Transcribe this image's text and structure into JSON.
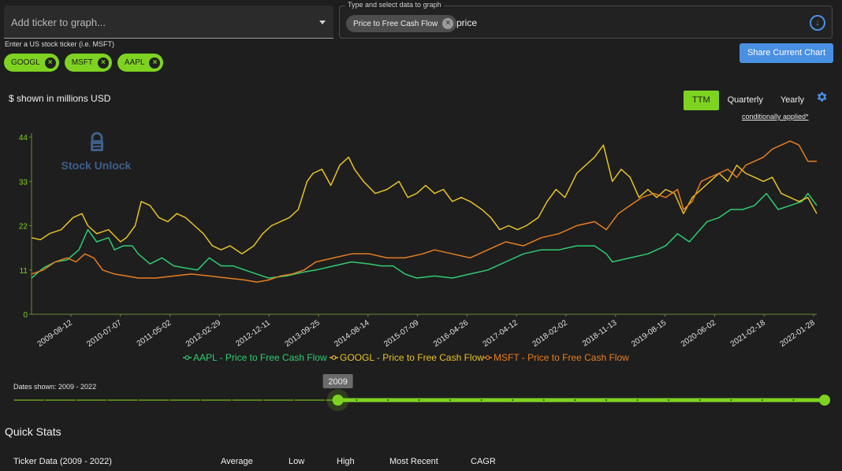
{
  "ticker_input": {
    "placeholder": "Add ticker to graph...",
    "helper": "Enter a US stock ticker (i.e. MSFT)"
  },
  "tickers": [
    {
      "label": "GOOGL",
      "remove_icon": "close-circle-icon"
    },
    {
      "label": "MSFT",
      "remove_icon": "close-circle-icon"
    },
    {
      "label": "AAPL",
      "remove_icon": "close-circle-icon"
    }
  ],
  "data_select": {
    "label": "Type and select data to graph",
    "selected_metric": "Price to Free Cash Flow",
    "typed_text": "price",
    "dropdown_icon": "arrow-down-circle-icon"
  },
  "share_button": "Share Current Chart",
  "units_note": "$ shown in millions USD",
  "period_tabs": {
    "ttm": "TTM",
    "quarterly": "Quarterly",
    "yearly": "Yearly",
    "active": "TTM"
  },
  "settings_icon": "gear-icon",
  "conditional_note": "conditionally applied*",
  "watermark": "Stock Unlock",
  "accent_color": "#7ed321",
  "button_color": "#4a90e2",
  "chart_data": {
    "type": "line",
    "title": "",
    "xlabel": "",
    "ylabel": "",
    "ylim": [
      0,
      44
    ],
    "yticks": [
      0,
      11,
      22,
      33,
      44
    ],
    "x_ticks": [
      "2009-08-12",
      "2010-07-07",
      "2011-05-02",
      "2012-02-29",
      "2012-12-11",
      "2013-09-25",
      "2014-08-14",
      "2015-07-09",
      "2016-04-26",
      "2017-04-12",
      "2018-02-02",
      "2018-11-13",
      "2019-08-15",
      "2020-06-02",
      "2021-02-18",
      "2022-01-28"
    ],
    "x_range": [
      2009.2,
      2022.45
    ],
    "grid": false,
    "legend_position": "bottom",
    "series": [
      {
        "name": "AAPL - Price to Free Cash Flow",
        "color": "#2ecc71",
        "points": [
          [
            2009.2,
            9
          ],
          [
            2009.4,
            11.5
          ],
          [
            2009.6,
            13
          ],
          [
            2009.8,
            13.5
          ],
          [
            2010.0,
            16
          ],
          [
            2010.15,
            21
          ],
          [
            2010.3,
            18
          ],
          [
            2010.5,
            19
          ],
          [
            2010.6,
            16
          ],
          [
            2010.75,
            17
          ],
          [
            2010.9,
            17
          ],
          [
            2011.0,
            15
          ],
          [
            2011.2,
            12.5
          ],
          [
            2011.4,
            14
          ],
          [
            2011.6,
            12
          ],
          [
            2011.8,
            11.5
          ],
          [
            2012.0,
            11
          ],
          [
            2012.2,
            14
          ],
          [
            2012.4,
            12
          ],
          [
            2012.6,
            12
          ],
          [
            2012.8,
            11
          ],
          [
            2013.0,
            10
          ],
          [
            2013.2,
            9
          ],
          [
            2013.5,
            9.5
          ],
          [
            2013.8,
            10.5
          ],
          [
            2014.0,
            11
          ],
          [
            2014.3,
            12
          ],
          [
            2014.6,
            13
          ],
          [
            2014.9,
            12.5
          ],
          [
            2015.1,
            12
          ],
          [
            2015.3,
            12
          ],
          [
            2015.5,
            10
          ],
          [
            2015.7,
            9
          ],
          [
            2016.0,
            9.5
          ],
          [
            2016.3,
            9
          ],
          [
            2016.6,
            10
          ],
          [
            2016.9,
            11
          ],
          [
            2017.2,
            13
          ],
          [
            2017.5,
            15
          ],
          [
            2017.8,
            16
          ],
          [
            2018.1,
            16
          ],
          [
            2018.4,
            17
          ],
          [
            2018.7,
            17
          ],
          [
            2018.9,
            15
          ],
          [
            2019.0,
            13
          ],
          [
            2019.3,
            14
          ],
          [
            2019.6,
            15
          ],
          [
            2019.9,
            17
          ],
          [
            2020.1,
            20
          ],
          [
            2020.3,
            18
          ],
          [
            2020.6,
            23
          ],
          [
            2020.8,
            24
          ],
          [
            2021.0,
            26
          ],
          [
            2021.2,
            26
          ],
          [
            2021.4,
            27
          ],
          [
            2021.6,
            30
          ],
          [
            2021.8,
            26
          ],
          [
            2022.0,
            27
          ],
          [
            2022.2,
            28
          ],
          [
            2022.3,
            30
          ],
          [
            2022.45,
            27
          ]
        ]
      },
      {
        "name": "GOOGL - Price to Free Cash Flow",
        "color": "#e6c229",
        "points": [
          [
            2009.2,
            19
          ],
          [
            2009.35,
            18.5
          ],
          [
            2009.5,
            20
          ],
          [
            2009.7,
            21
          ],
          [
            2009.9,
            24
          ],
          [
            2010.05,
            25
          ],
          [
            2010.15,
            22
          ],
          [
            2010.3,
            20
          ],
          [
            2010.5,
            21
          ],
          [
            2010.7,
            18
          ],
          [
            2010.8,
            19
          ],
          [
            2010.95,
            22
          ],
          [
            2011.05,
            28
          ],
          [
            2011.2,
            27
          ],
          [
            2011.35,
            24
          ],
          [
            2011.5,
            23
          ],
          [
            2011.65,
            25
          ],
          [
            2011.8,
            24
          ],
          [
            2011.95,
            22
          ],
          [
            2012.1,
            20
          ],
          [
            2012.25,
            17
          ],
          [
            2012.4,
            16
          ],
          [
            2012.55,
            17
          ],
          [
            2012.75,
            15
          ],
          [
            2012.95,
            17
          ],
          [
            2013.1,
            20
          ],
          [
            2013.25,
            22
          ],
          [
            2013.4,
            23
          ],
          [
            2013.55,
            24
          ],
          [
            2013.7,
            26
          ],
          [
            2013.85,
            33
          ],
          [
            2013.95,
            35
          ],
          [
            2014.1,
            36
          ],
          [
            2014.25,
            32
          ],
          [
            2014.4,
            37
          ],
          [
            2014.55,
            39
          ],
          [
            2014.65,
            36
          ],
          [
            2014.8,
            33
          ],
          [
            2015.0,
            30
          ],
          [
            2015.2,
            31
          ],
          [
            2015.4,
            33
          ],
          [
            2015.55,
            29
          ],
          [
            2015.7,
            30
          ],
          [
            2015.85,
            32
          ],
          [
            2016.0,
            30
          ],
          [
            2016.15,
            31
          ],
          [
            2016.3,
            28
          ],
          [
            2016.45,
            29
          ],
          [
            2016.6,
            28
          ],
          [
            2016.8,
            26
          ],
          [
            2016.95,
            24
          ],
          [
            2017.1,
            21
          ],
          [
            2017.25,
            22
          ],
          [
            2017.4,
            21
          ],
          [
            2017.55,
            22
          ],
          [
            2017.75,
            24
          ],
          [
            2017.9,
            28
          ],
          [
            2018.05,
            31
          ],
          [
            2018.2,
            29
          ],
          [
            2018.4,
            35
          ],
          [
            2018.55,
            37
          ],
          [
            2018.7,
            39
          ],
          [
            2018.85,
            42
          ],
          [
            2019.0,
            33
          ],
          [
            2019.15,
            36
          ],
          [
            2019.3,
            34
          ],
          [
            2019.45,
            29
          ],
          [
            2019.6,
            31
          ],
          [
            2019.75,
            29
          ],
          [
            2019.9,
            31
          ],
          [
            2020.05,
            30
          ],
          [
            2020.2,
            25
          ],
          [
            2020.35,
            29
          ],
          [
            2020.5,
            31
          ],
          [
            2020.65,
            33
          ],
          [
            2020.8,
            35
          ],
          [
            2020.95,
            33
          ],
          [
            2021.1,
            37
          ],
          [
            2021.25,
            35
          ],
          [
            2021.4,
            34
          ],
          [
            2021.55,
            33
          ],
          [
            2021.7,
            34
          ],
          [
            2021.85,
            30
          ],
          [
            2022.0,
            29
          ],
          [
            2022.15,
            28
          ],
          [
            2022.3,
            29
          ],
          [
            2022.45,
            25
          ]
        ]
      },
      {
        "name": "MSFT - Price to Free Cash Flow",
        "color": "#e67e22",
        "points": [
          [
            2009.2,
            10
          ],
          [
            2009.4,
            11
          ],
          [
            2009.6,
            13
          ],
          [
            2009.8,
            14
          ],
          [
            2009.95,
            13
          ],
          [
            2010.1,
            15
          ],
          [
            2010.25,
            14
          ],
          [
            2010.4,
            11
          ],
          [
            2010.6,
            10
          ],
          [
            2010.8,
            9.5
          ],
          [
            2011.0,
            9
          ],
          [
            2011.3,
            9
          ],
          [
            2011.6,
            9.5
          ],
          [
            2011.9,
            10
          ],
          [
            2012.2,
            9.5
          ],
          [
            2012.5,
            9
          ],
          [
            2012.8,
            8.5
          ],
          [
            2013.0,
            8
          ],
          [
            2013.2,
            8.5
          ],
          [
            2013.4,
            9.5
          ],
          [
            2013.6,
            10
          ],
          [
            2013.8,
            11
          ],
          [
            2014.0,
            13
          ],
          [
            2014.3,
            14
          ],
          [
            2014.6,
            15
          ],
          [
            2014.9,
            15
          ],
          [
            2015.2,
            14
          ],
          [
            2015.5,
            14
          ],
          [
            2015.8,
            15
          ],
          [
            2016.0,
            16
          ],
          [
            2016.3,
            15
          ],
          [
            2016.6,
            14
          ],
          [
            2016.9,
            16
          ],
          [
            2017.2,
            18
          ],
          [
            2017.5,
            17
          ],
          [
            2017.8,
            19
          ],
          [
            2018.1,
            20
          ],
          [
            2018.4,
            22
          ],
          [
            2018.7,
            23
          ],
          [
            2018.9,
            21
          ],
          [
            2019.1,
            25
          ],
          [
            2019.3,
            27
          ],
          [
            2019.5,
            29
          ],
          [
            2019.7,
            30
          ],
          [
            2019.9,
            29
          ],
          [
            2020.1,
            31
          ],
          [
            2020.2,
            26
          ],
          [
            2020.35,
            28
          ],
          [
            2020.5,
            33
          ],
          [
            2020.65,
            34
          ],
          [
            2020.8,
            35
          ],
          [
            2020.95,
            36
          ],
          [
            2021.1,
            34
          ],
          [
            2021.25,
            37
          ],
          [
            2021.4,
            38
          ],
          [
            2021.55,
            39
          ],
          [
            2021.7,
            41
          ],
          [
            2021.85,
            42
          ],
          [
            2022.0,
            43
          ],
          [
            2022.15,
            42
          ],
          [
            2022.3,
            38
          ],
          [
            2022.45,
            38
          ]
        ]
      }
    ]
  },
  "date_range": {
    "caption": "Dates shown: 2009 - 2022",
    "start_tooltip": "2009",
    "start_fraction": 0.4,
    "end_fraction": 1.0
  },
  "quick_stats": {
    "title": "Quick Stats",
    "columns": [
      "Ticker Data (2009 - 2022)",
      "Average",
      "Low",
      "High",
      "Most Recent",
      "CAGR"
    ]
  }
}
